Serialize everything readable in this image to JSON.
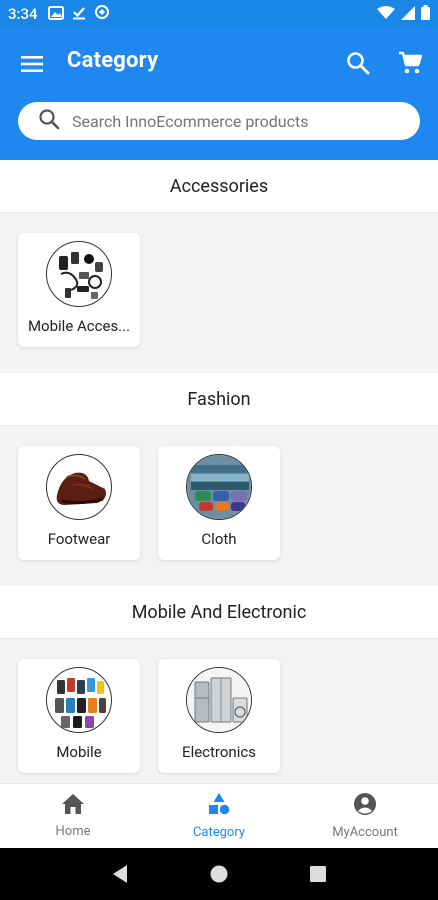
{
  "status_bar": {
    "time": "3:34",
    "left_icons": [
      "gallery-icon",
      "download-done-icon",
      "sync-icon"
    ],
    "right_icons": [
      "wifi-icon",
      "signal-icon",
      "battery-icon"
    ]
  },
  "app_bar": {
    "title": "Category",
    "menu_icon": "menu-icon",
    "search_icon": "search-icon",
    "cart_icon": "cart-icon",
    "background": "#1e88f0"
  },
  "search": {
    "placeholder": "Search InnoEcommerce products"
  },
  "sections": [
    {
      "title": "Accessories",
      "items": [
        {
          "label": "Mobile Acces...",
          "image": "mobile-accessories-thumbnail"
        }
      ]
    },
    {
      "title": "Fashion",
      "items": [
        {
          "label": "Footwear",
          "image": "footwear-thumbnail"
        },
        {
          "label": "Cloth",
          "image": "cloth-thumbnail"
        }
      ]
    },
    {
      "title": "Mobile And Electronic",
      "items": [
        {
          "label": "Mobile",
          "image": "mobile-thumbnail"
        },
        {
          "label": "Electronics",
          "image": "electronics-thumbnail"
        }
      ]
    }
  ],
  "bottom_nav": {
    "items": [
      {
        "label": "Home",
        "icon": "home-icon",
        "active": false
      },
      {
        "label": "Category",
        "icon": "category-icon",
        "active": true
      },
      {
        "label": "MyAccount",
        "icon": "account-circle-icon",
        "active": false
      }
    ],
    "active_color": "#1e88f0"
  },
  "system_nav": {
    "buttons": [
      "back-icon",
      "home-circle-icon",
      "recents-icon"
    ]
  }
}
